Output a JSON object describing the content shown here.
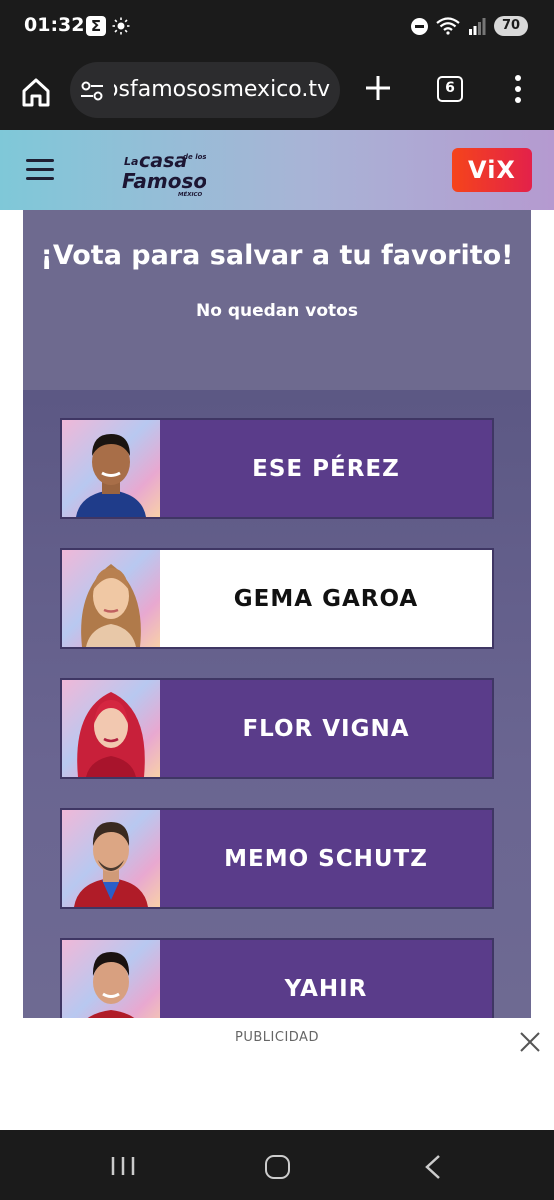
{
  "status_bar": {
    "time": "01:32",
    "sigma": "Σ",
    "battery": "70"
  },
  "browser": {
    "url": "lacasadelosfamososmexico.tv",
    "tab_count": "6"
  },
  "site": {
    "vix_label": "ViX"
  },
  "vote": {
    "title": "¡Vota para salvar a tu favorito!",
    "subtitle": "No quedan votos",
    "candidates": [
      {
        "name": "ESE PÉREZ",
        "selected": false
      },
      {
        "name": "GEMA GAROA",
        "selected": true
      },
      {
        "name": "FLOR VIGNA",
        "selected": false
      },
      {
        "name": "MEMO SCHUTZ",
        "selected": false
      },
      {
        "name": "YAHIR",
        "selected": false
      }
    ]
  },
  "ad": {
    "label": "PUBLICIDAD"
  },
  "colors": {
    "card_bg": "#5a3c8a",
    "panel_bg": "#6e6a8f",
    "vix_red": "#f5441b"
  }
}
